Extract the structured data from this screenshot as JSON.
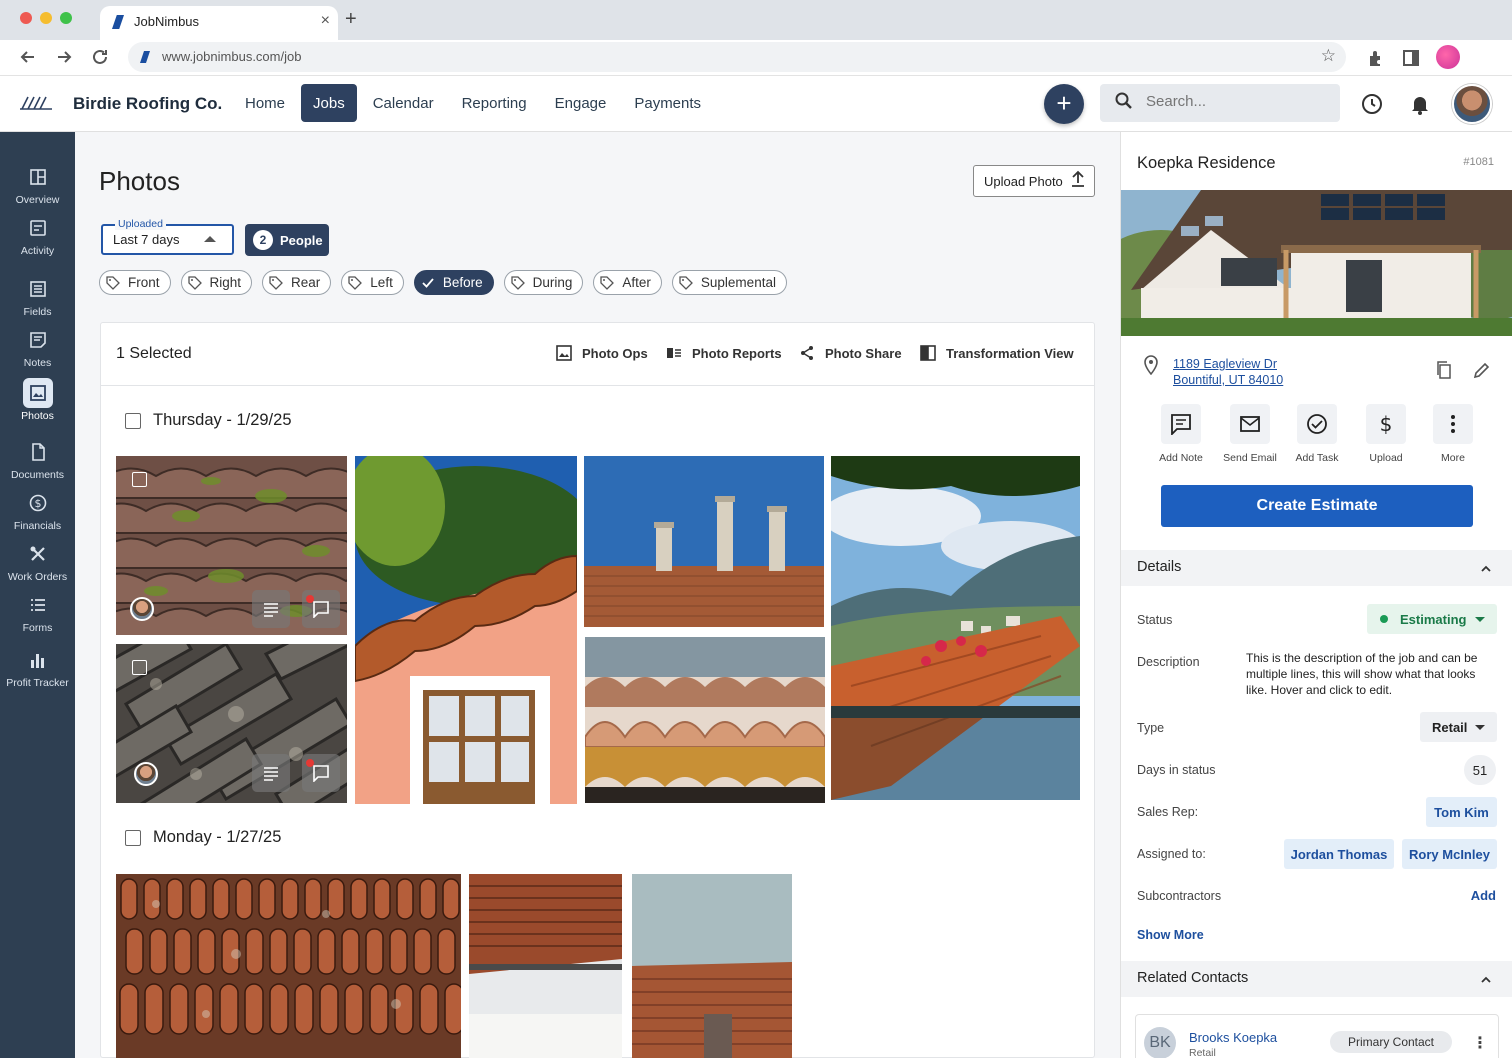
{
  "browser": {
    "tab_title": "JobNimbus",
    "url": "www.jobnimbus.com/job"
  },
  "header": {
    "brand": "Birdie Roofing Co.",
    "nav": [
      "Home",
      "Jobs",
      "Calendar",
      "Reporting",
      "Engage",
      "Payments"
    ],
    "active_nav": "Jobs",
    "search_placeholder": "Search..."
  },
  "sidebar": {
    "items": [
      {
        "label": "Overview",
        "icon": "overview-icon"
      },
      {
        "label": "Activity",
        "icon": "activity-icon"
      },
      {
        "label": "Fields",
        "icon": "fields-icon"
      },
      {
        "label": "Notes",
        "icon": "notes-icon"
      },
      {
        "label": "Photos",
        "icon": "photos-icon",
        "active": true
      },
      {
        "label": "Documents",
        "icon": "documents-icon"
      },
      {
        "label": "Financials",
        "icon": "dollar-icon"
      },
      {
        "label": "Work Orders",
        "icon": "tools-icon"
      },
      {
        "label": "Forms",
        "icon": "list-icon"
      },
      {
        "label": "Profit Tracker",
        "icon": "chart-icon"
      }
    ]
  },
  "photos": {
    "title": "Photos",
    "upload_label": "Upload Photo",
    "filter": {
      "label": "Uploaded",
      "value": "Last 7 days"
    },
    "people": {
      "count": "2",
      "label": "People"
    },
    "tags": [
      "Front",
      "Right",
      "Rear",
      "Left",
      "Before",
      "During",
      "After",
      "Suplemental"
    ],
    "active_tag": "Before",
    "selected": "1 Selected",
    "actions": [
      "Photo Ops",
      "Photo Reports",
      "Photo Share",
      "Transformation View"
    ],
    "groups": [
      "Thursday - 1/29/25",
      "Monday - 1/27/25"
    ]
  },
  "job": {
    "name": "Koepka Residence",
    "number": "#1081",
    "address_line1": "1189 Eagleview Dr",
    "address_line2": "Bountiful, UT 84010",
    "quick_actions": [
      "Add Note",
      "Send Email",
      "Add Task",
      "Upload",
      "More"
    ],
    "create_estimate": "Create Estimate",
    "details_title": "Details",
    "labels": {
      "status": "Status",
      "description": "Description",
      "type": "Type",
      "days": "Days in status",
      "sales_rep": "Sales Rep:",
      "assigned": "Assigned to:",
      "subcontractors": "Subcontractors"
    },
    "status": "Estimating",
    "status_color": "#1a9a55",
    "description": "This is the description of the job and can be multiple lines, this will show what that looks like.  Hover and click to edit.",
    "type": "Retail",
    "days_in_status": "51",
    "sales_rep": "Tom Kim",
    "assigned_to": [
      "Jordan Thomas",
      "Rory McInley"
    ],
    "subcontractors_action": "Add",
    "show_more": "Show More",
    "related_contacts_title": "Related Contacts",
    "contact": {
      "initials": "BK",
      "name": "Brooks Koepka",
      "type": "Retail",
      "badge": "Primary Contact"
    }
  }
}
